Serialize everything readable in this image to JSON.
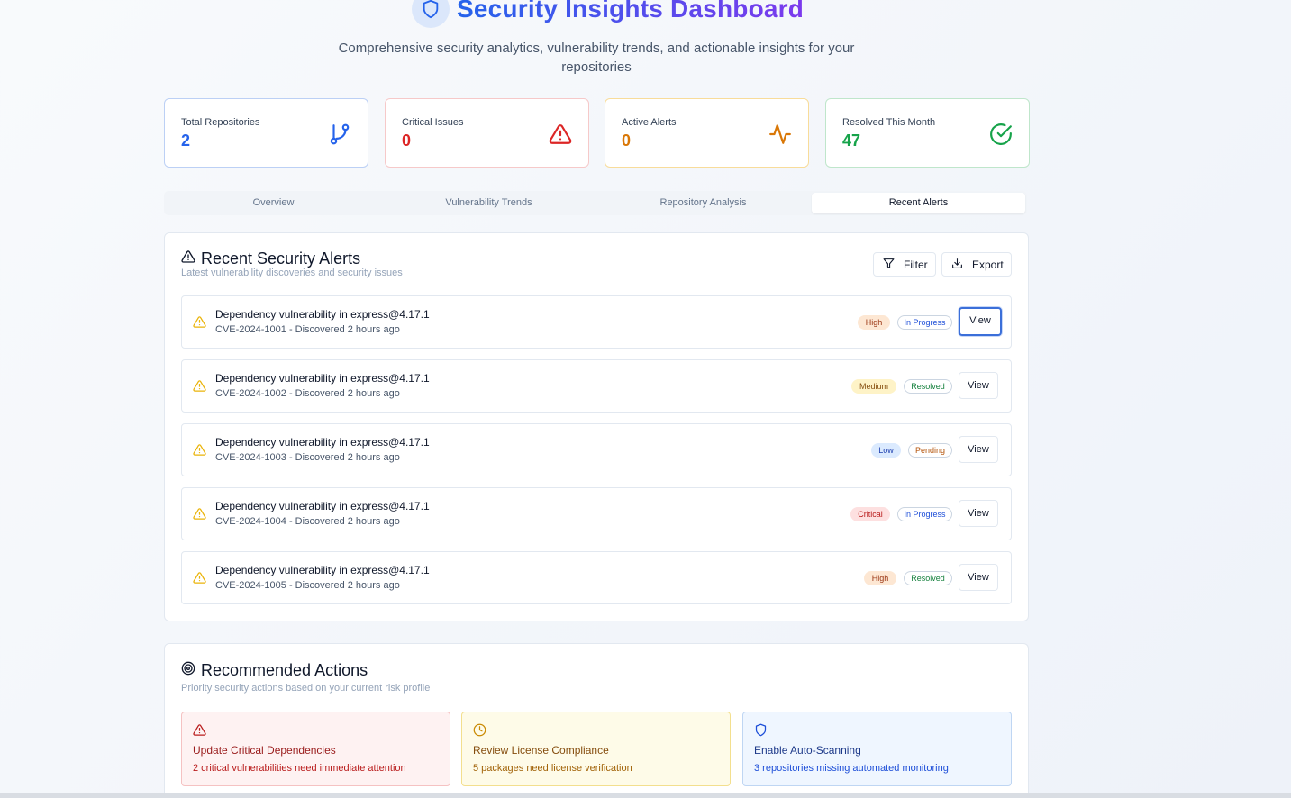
{
  "header": {
    "title": "Security Insights Dashboard",
    "subtitle": "Comprehensive security analytics, vulnerability trends, and actionable insights for your repositories"
  },
  "stats": [
    {
      "label": "Total Repositories",
      "value": "2",
      "color": "#2563eb",
      "icon": "git-branch-icon"
    },
    {
      "label": "Critical Issues",
      "value": "0",
      "color": "#dc2626",
      "icon": "alert-triangle-icon"
    },
    {
      "label": "Active Alerts",
      "value": "0",
      "color": "#d97706",
      "icon": "activity-icon"
    },
    {
      "label": "Resolved This Month",
      "value": "47",
      "color": "#16a34a",
      "icon": "check-circle-icon"
    }
  ],
  "tabs": [
    {
      "label": "Overview",
      "active": false
    },
    {
      "label": "Vulnerability Trends",
      "active": false
    },
    {
      "label": "Repository Analysis",
      "active": false
    },
    {
      "label": "Recent Alerts",
      "active": true
    }
  ],
  "alerts_panel": {
    "title": "Recent Security Alerts",
    "subtitle": "Latest vulnerability discoveries and security issues",
    "filter_label": "Filter",
    "export_label": "Export",
    "view_label": "View",
    "items": [
      {
        "title": "Dependency vulnerability in express@4.17.1",
        "sub": "CVE-2024-1001 - Discovered 2 hours ago",
        "severity": "High",
        "status": "In Progress"
      },
      {
        "title": "Dependency vulnerability in express@4.17.1",
        "sub": "CVE-2024-1002 - Discovered 2 hours ago",
        "severity": "Medium",
        "status": "Resolved"
      },
      {
        "title": "Dependency vulnerability in express@4.17.1",
        "sub": "CVE-2024-1003 - Discovered 2 hours ago",
        "severity": "Low",
        "status": "Pending"
      },
      {
        "title": "Dependency vulnerability in express@4.17.1",
        "sub": "CVE-2024-1004 - Discovered 2 hours ago",
        "severity": "Critical",
        "status": "In Progress"
      },
      {
        "title": "Dependency vulnerability in express@4.17.1",
        "sub": "CVE-2024-1005 - Discovered 2 hours ago",
        "severity": "High",
        "status": "Resolved"
      }
    ]
  },
  "actions_panel": {
    "title": "Recommended Actions",
    "subtitle": "Priority security actions based on your current risk profile",
    "cards": [
      {
        "title": "Update Critical Dependencies",
        "sub": "2 critical vulnerabilities need immediate attention",
        "icon": "alert-triangle-icon",
        "color": "#b91c1c"
      },
      {
        "title": "Review License Compliance",
        "sub": "5 packages need license verification",
        "icon": "clock-icon",
        "color": "#a16207"
      },
      {
        "title": "Enable Auto-Scanning",
        "sub": "3 repositories missing automated monitoring",
        "icon": "shield-icon",
        "color": "#1d4ed8"
      }
    ]
  }
}
